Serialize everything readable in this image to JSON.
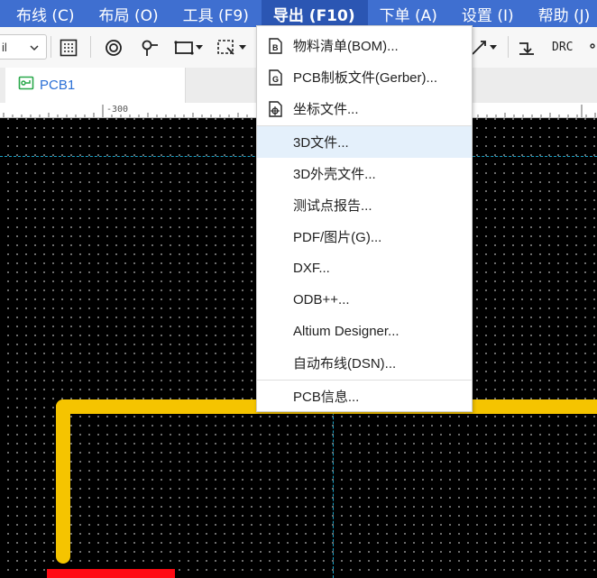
{
  "menubar": {
    "items": [
      {
        "label": "布线 (C)"
      },
      {
        "label": "布局 (O)"
      },
      {
        "label": "工具 (F9)"
      },
      {
        "label": "导出 (F10)"
      },
      {
        "label": "下单 (A)"
      },
      {
        "label": "设置 (I)"
      },
      {
        "label": "帮助 (J)"
      }
    ],
    "active_color": "#2b56b3",
    "bar_color": "#3f6fd0"
  },
  "toolbar": {
    "unit_value": "il",
    "drc_label": "DRC"
  },
  "tabs": {
    "active": {
      "label": "PCB1",
      "icon": "pcb-icon"
    }
  },
  "ruler": {
    "label": "-300"
  },
  "export_menu": {
    "items": [
      {
        "label": "物料清单(BOM)...",
        "icon": "bom-icon"
      },
      {
        "label": "PCB制板文件(Gerber)...",
        "icon": "gerber-icon"
      },
      {
        "label": "坐标文件...",
        "icon": "coordinate-icon"
      },
      {
        "label": "3D文件...",
        "icon": ""
      },
      {
        "label": "3D外壳文件...",
        "icon": ""
      },
      {
        "label": "测试点报告...",
        "icon": ""
      },
      {
        "label": "PDF/图片(G)...",
        "icon": ""
      },
      {
        "label": "DXF...",
        "icon": ""
      },
      {
        "label": "ODB++...",
        "icon": ""
      },
      {
        "label": "Altium Designer...",
        "icon": ""
      },
      {
        "label": "自动布线(DSN)...",
        "icon": ""
      },
      {
        "label": "PCB信息...",
        "icon": ""
      }
    ],
    "hovered_index": 3,
    "hover_color": "#e4f0fb"
  },
  "canvas": {
    "track_color": "#f5c400",
    "pad_color": "#ff0a14",
    "guide_color": "#1aa3c8"
  }
}
